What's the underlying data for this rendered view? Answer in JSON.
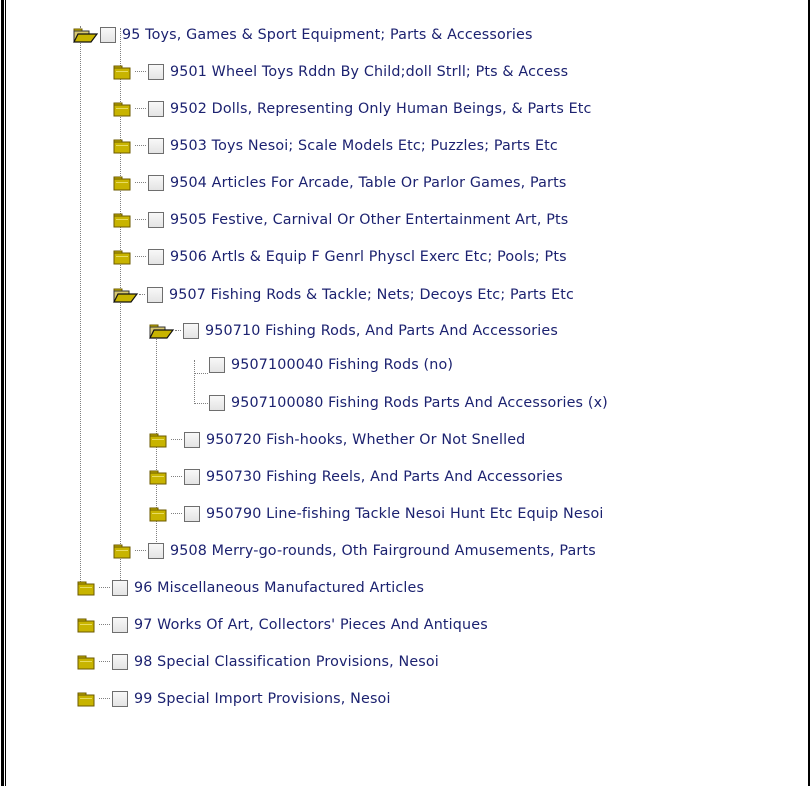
{
  "tree": {
    "chapter95": {
      "label": "95 Toys, Games & Sport Equipment; Parts & Accessories",
      "icon": "open-folder-icon"
    },
    "headings": [
      {
        "label": "9501 Wheel Toys Rddn By Child;doll Strll; Pts & Access",
        "icon": "closed-folder-icon"
      },
      {
        "label": "9502 Dolls, Representing Only Human Beings, & Parts Etc",
        "icon": "closed-folder-icon"
      },
      {
        "label": "9503 Toys Nesoi; Scale Models Etc; Puzzles; Parts Etc",
        "icon": "closed-folder-icon"
      },
      {
        "label": "9504 Articles For Arcade, Table Or Parlor Games, Parts",
        "icon": "closed-folder-icon"
      },
      {
        "label": "9505 Festive, Carnival Or Other Entertainment Art, Pts",
        "icon": "closed-folder-icon"
      },
      {
        "label": "9506 Artls & Equip F Genrl Physcl Exerc Etc; Pools; Pts",
        "icon": "closed-folder-icon"
      },
      {
        "label": "9507 Fishing Rods & Tackle; Nets; Decoys Etc; Parts Etc",
        "icon": "open-folder-icon"
      }
    ],
    "subheadings": [
      {
        "label": "950710 Fishing Rods, And Parts And Accessories",
        "icon": "open-folder-icon"
      },
      {
        "label": "950720 Fish-hooks, Whether Or Not Snelled",
        "icon": "closed-folder-icon"
      },
      {
        "label": "950730 Fishing Reels, And Parts And Accessories",
        "icon": "closed-folder-icon"
      },
      {
        "label": "950790 Line-fishing Tackle Nesoi Hunt Etc Equip Nesoi",
        "icon": "closed-folder-icon"
      }
    ],
    "leaves": [
      {
        "label": "9507100040 Fishing Rods (no)"
      },
      {
        "label": "9507100080 Fishing Rods Parts And Accessories (x)"
      }
    ],
    "heading9508": {
      "label": "9508 Merry-go-rounds, Oth Fairground Amusements, Parts",
      "icon": "closed-folder-icon"
    },
    "chapters": [
      {
        "label": "96 Miscellaneous Manufactured Articles",
        "icon": "closed-folder-icon"
      },
      {
        "label": "97 Works Of Art, Collectors' Pieces And Antiques",
        "icon": "closed-folder-icon"
      },
      {
        "label": "98 Special Classification Provisions, Nesoi",
        "icon": "closed-folder-icon"
      },
      {
        "label": "99 Special Import Provisions, Nesoi",
        "icon": "closed-folder-icon"
      }
    ]
  },
  "colors": {
    "label": "#1c2270",
    "folder": "#c8b400",
    "folder_dark": "#6b5a00",
    "connector": "#808080"
  }
}
